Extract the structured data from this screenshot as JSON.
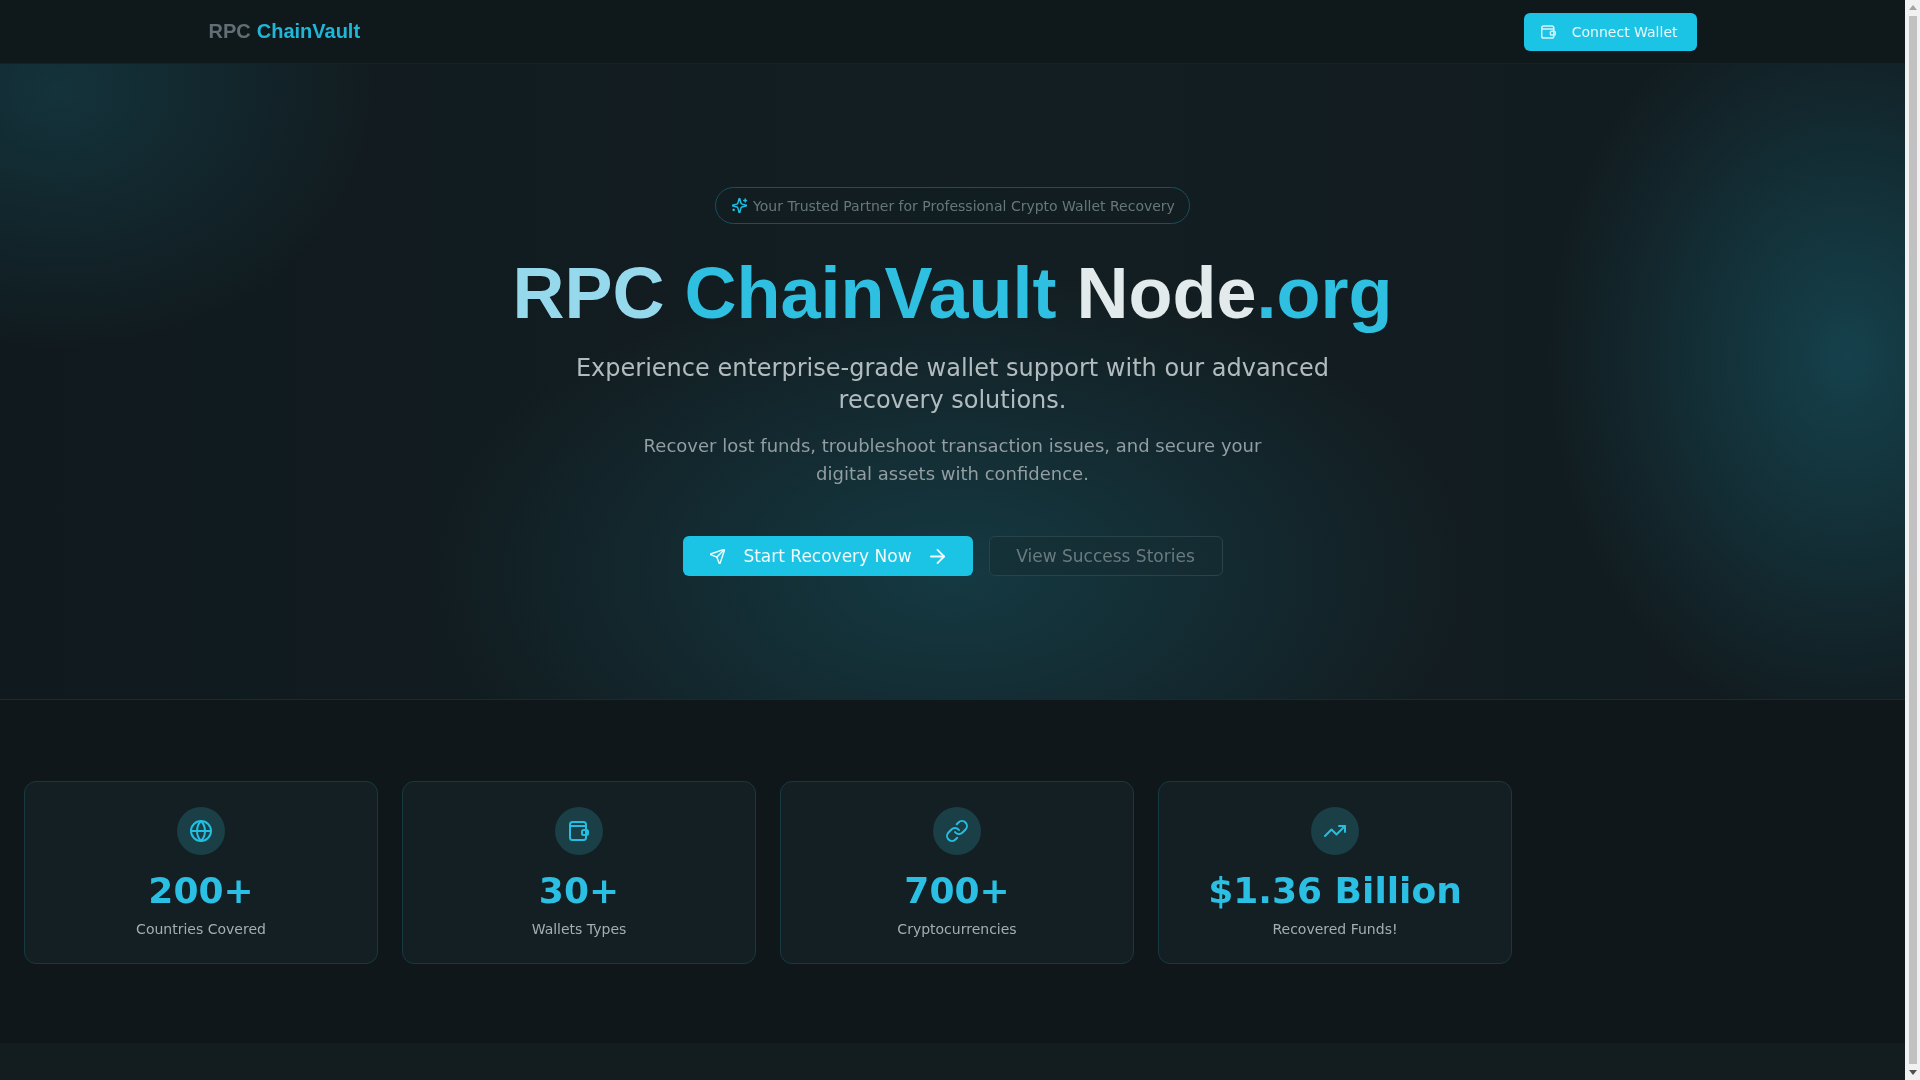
{
  "header": {
    "logo": [
      {
        "text": "RPC",
        "kind": "muted"
      },
      {
        "text": "ChainVault",
        "kind": "accent"
      }
    ],
    "connect_button": {
      "label": "Connect Wallet"
    }
  },
  "hero": {
    "badge": "Your Trusted Partner for Professional Crypto Wallet Recovery",
    "title": [
      {
        "text": "RPC ",
        "kind": "pale"
      },
      {
        "text": "ChainVault ",
        "kind": "accent"
      },
      {
        "text": "Node",
        "kind": "plain"
      },
      {
        "text": ".org",
        "kind": "accent"
      }
    ],
    "subtitle": "Experience enterprise-grade wallet support with our advanced recovery solutions.",
    "description": "Recover lost funds, troubleshoot transaction issues, and secure your digital assets with confidence.",
    "buttons": [
      {
        "label": "Start Recovery Now",
        "kind": "primary"
      },
      {
        "label": "View Success Stories",
        "kind": "outline"
      }
    ]
  },
  "stats": [
    {
      "value": "200+",
      "label": "Countries Covered"
    },
    {
      "value": "30+",
      "label": "Wallets Types"
    },
    {
      "value": "700+",
      "label": "Cryptocurrencies"
    },
    {
      "value": "$1.36 Billion",
      "label": "Recovered Funds!"
    }
  ]
}
